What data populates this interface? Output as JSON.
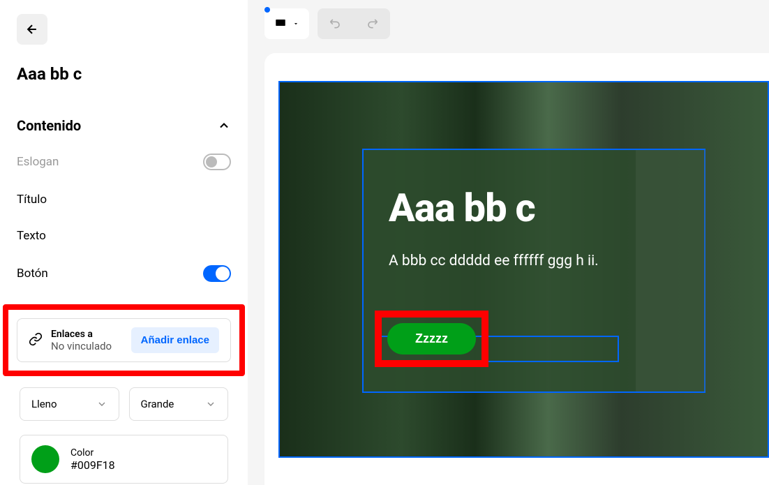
{
  "sidebar": {
    "title": "Aaa bb c",
    "section_contenido": "Contenido",
    "eslogan_label": "Eslogan",
    "titulo_label": "Título",
    "texto_label": "Texto",
    "boton_label": "Botón",
    "link": {
      "label": "Enlaces a",
      "status": "No vinculado",
      "add_label": "Añadir enlace"
    },
    "selects": {
      "fill": "Lleno",
      "size": "Grande"
    },
    "color": {
      "label": "Color",
      "value": "#009F18"
    }
  },
  "hero": {
    "title": "Aaa bb c",
    "text": "A bbb cc ddddd ee ffffff ggg h ii.",
    "button": "Zzzzz"
  }
}
